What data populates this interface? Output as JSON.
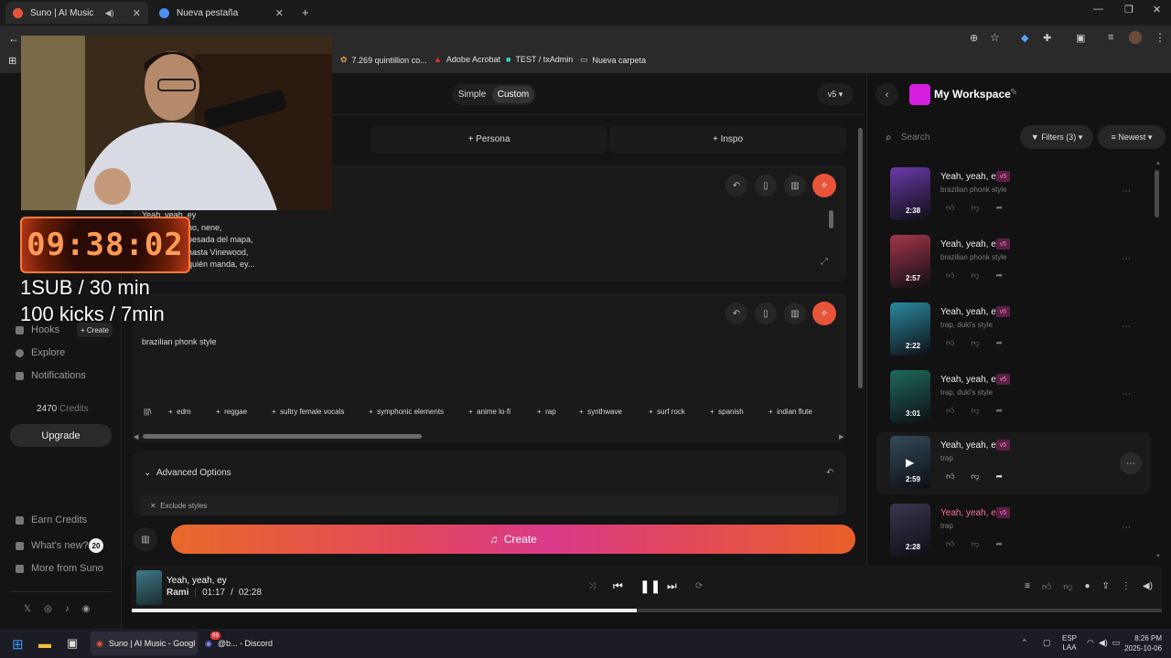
{
  "browser": {
    "tabs": [
      {
        "label": "Suno | AI Music"
      },
      {
        "label": "Nueva pestaña"
      }
    ],
    "bookmarks": [
      "7.269 quintillion co...",
      "Adobe Acrobat",
      "TEST / txAdmin",
      "Nueva carpeta"
    ]
  },
  "sidebar": {
    "items": [
      "Hooks",
      "Explore",
      "Notifications"
    ],
    "create_small": "+ Create",
    "credits_value": "2470",
    "credits_label": "Credits",
    "upgrade": "Upgrade",
    "bottom": [
      "Earn Credits",
      "What's new?",
      "More from Suno"
    ],
    "whats_new_count": "20",
    "partial_create": "Create"
  },
  "editor": {
    "mode_tabs": [
      "Simple",
      "Custom"
    ],
    "version": "v5",
    "add_buttons": [
      "+ Persona",
      "+ Inspo"
    ],
    "lyrics_lines": [
      "Yeah, yeah, ey",
      "no, nene,",
      "pesada del mapa,",
      "hasta Vinewood,",
      "quién manda, ey..."
    ],
    "styles_text": "brazilian phonk style",
    "chips": [
      "edm",
      "reggae",
      "sultry female vocals",
      "symphonic elements",
      "anime lo-fi",
      "rap",
      "synthwave",
      "surf rock",
      "spanish",
      "indian flute"
    ],
    "advanced": "Advanced Options",
    "exclude": "Exclude styles",
    "create": "Create"
  },
  "workspace": {
    "title": "My Workspace",
    "search_placeholder": "Search",
    "filters": "Filters (3)",
    "sort": "Newest",
    "songs": [
      {
        "title": "Yeah, yeah, ey",
        "style": "brazilian phonk style",
        "duration": "2:38",
        "badge": "v5",
        "color": "#6a3aa8"
      },
      {
        "title": "Yeah, yeah, ey",
        "style": "brazilian phonk style",
        "duration": "2:57",
        "badge": "v5",
        "color": "#a3364a"
      },
      {
        "title": "Yeah, yeah, ey",
        "style": "trap, duki's style",
        "duration": "2:22",
        "badge": "v5",
        "color": "#2a8aa0"
      },
      {
        "title": "Yeah, yeah, ey",
        "style": "trap, duki's style",
        "duration": "3:01",
        "badge": "v5",
        "color": "#1e6a5a"
      },
      {
        "title": "Yeah, yeah, ey",
        "style": "trap",
        "duration": "2:59",
        "badge": "v5",
        "color": "#334a5a"
      },
      {
        "title": "Yeah, yeah, ey",
        "style": "trap",
        "duration": "2:28",
        "badge": "v5",
        "color": "#3a3550"
      }
    ]
  },
  "player": {
    "title": "Yeah, yeah, ey",
    "artist": "Rami",
    "current": "01:17",
    "sep": "/",
    "total": "02:28",
    "progress": 0.49
  },
  "overlay": {
    "timer": "09:38:02",
    "line1": "1SUB / 30 min",
    "line2": "100 kicks / 7min"
  },
  "taskbar": {
    "apps": [
      "Suno | AI Music - Googl",
      "@b... - Discord"
    ],
    "discord_badge": "99",
    "lang": "ESP",
    "lang2": "LAA",
    "time": "8:26 PM",
    "date": "2025-10-06"
  }
}
